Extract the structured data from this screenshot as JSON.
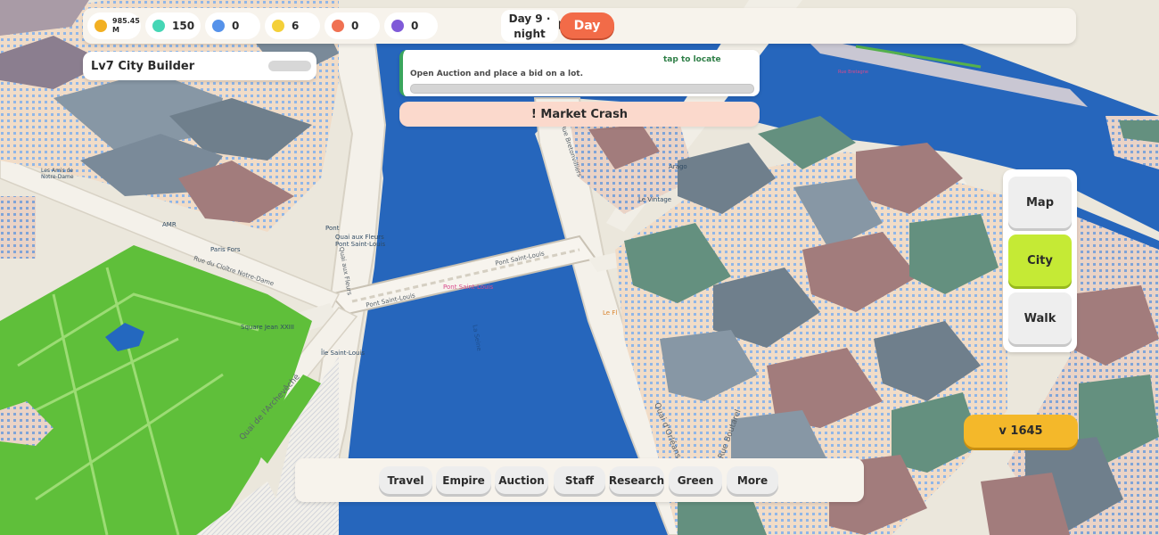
{
  "resources": [
    {
      "name": "money",
      "value": "985.45\nM",
      "color": "#f2b023"
    },
    {
      "name": "teal",
      "value": "150",
      "color": "#45d6b5"
    },
    {
      "name": "blue",
      "value": "0",
      "color": "#5592ea"
    },
    {
      "name": "yellow",
      "value": "6",
      "color": "#f4d039"
    },
    {
      "name": "red",
      "value": "0",
      "color": "#f07152"
    },
    {
      "name": "purple",
      "value": "0",
      "color": "#7f5ad8"
    }
  ],
  "time": {
    "day_label": "Day 9  ·",
    "phase": "night",
    "toggle_label": "Day"
  },
  "level": {
    "label": "Lv7  City Builder",
    "progress": 0
  },
  "quest": {
    "locate": "tap to locate",
    "text": "Open Auction and place a bid on a lot.",
    "progress": 0
  },
  "alert": {
    "text": "! Market Crash"
  },
  "views": [
    {
      "label": "Map",
      "active": false
    },
    {
      "label": "City",
      "active": true
    },
    {
      "label": "Walk",
      "active": false
    }
  ],
  "currency": {
    "label": "v 1645"
  },
  "nav": [
    "Travel",
    "Empire",
    "Auction",
    "Staff",
    "Research",
    "Green",
    "More"
  ],
  "map_labels": {
    "pont_saint_louis_1": "Pont Saint-Louis",
    "pont_saint_louis_2": "Pont Saint-Louis",
    "pont_saint_louis_pink": "Pont Saint-Louis",
    "quai_fleurs": "Quai aux Fleurs",
    "rue_cloitre": "Rue du Cloître Notre-Dame",
    "quai_archeveche": "Quai de l'Archevêché",
    "quai_orleans": "Quai d'Orléans",
    "rue_boutarel": "Rue Boutarel",
    "rue_bretonvilliers": "Rue Bretonvilliers",
    "square_jean": "Square Jean XXIII",
    "ile_saint_louis": "Île Saint-Louis",
    "la_seine": "La Seine",
    "pont": "Pont",
    "quai_pont_sl": "Quai aux Fleurs\nPont Saint-Louis",
    "paris_fors": "Paris Fors",
    "amr": "AMR",
    "notre_dame": "Les Amis de\nNotre-Dame",
    "arago": "Arago",
    "vintage": "Le Vintage",
    "lf": "Le Fl",
    "rue_bretagne": "Rue Bretagne"
  }
}
